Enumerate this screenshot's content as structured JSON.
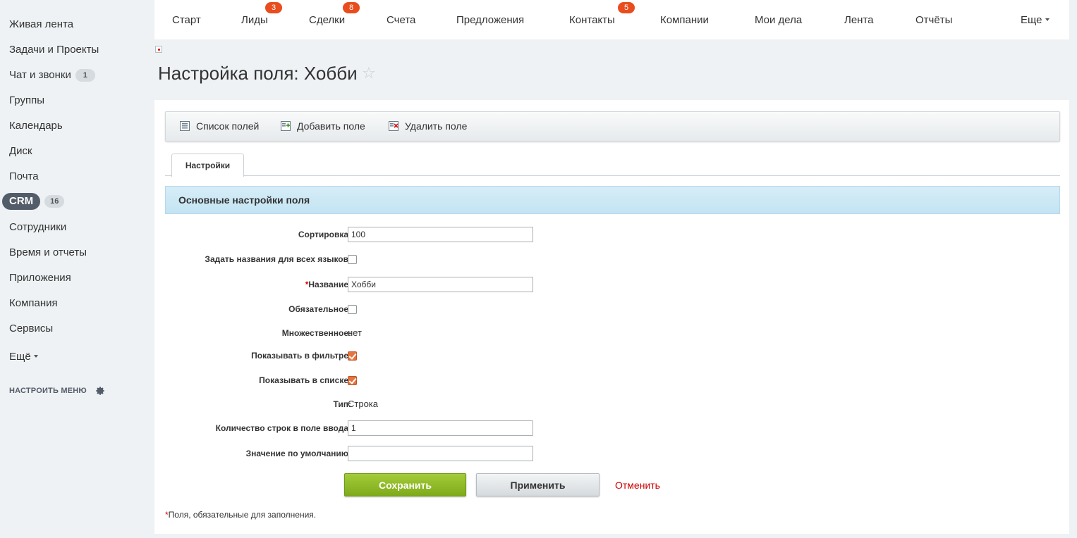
{
  "sidebar": {
    "items": [
      {
        "label": "Живая лента"
      },
      {
        "label": "Задачи и Проекты"
      },
      {
        "label": "Чат и звонки",
        "count": "1"
      },
      {
        "label": "Группы"
      },
      {
        "label": "Календарь"
      },
      {
        "label": "Диск"
      },
      {
        "label": "Почта"
      },
      {
        "label": "CRM",
        "count": "16",
        "active": true
      },
      {
        "label": "Сотрудники"
      },
      {
        "label": "Время и отчеты"
      },
      {
        "label": "Приложения"
      },
      {
        "label": "Компания"
      },
      {
        "label": "Сервисы"
      },
      {
        "label": "Ещё"
      }
    ],
    "config_label": "НАСТРОИТЬ МЕНЮ"
  },
  "topnav": {
    "items": [
      {
        "label": "Старт"
      },
      {
        "label": "Лиды",
        "badge": "3"
      },
      {
        "label": "Сделки",
        "badge": "8"
      },
      {
        "label": "Счета"
      },
      {
        "label": "Предложения"
      },
      {
        "label": "Контакты",
        "badge": "5"
      },
      {
        "label": "Компании"
      },
      {
        "label": "Мои дела"
      },
      {
        "label": "Лента"
      },
      {
        "label": "Отчёты"
      },
      {
        "label": "Еще"
      }
    ]
  },
  "page": {
    "title": "Настройка поля: Хобби",
    "star_icon": "star-outline-icon"
  },
  "toolbar": {
    "list_label": "Список полей",
    "add_label": "Добавить поле",
    "delete_label": "Удалить поле"
  },
  "tabs": [
    {
      "label": "Настройки"
    }
  ],
  "section": {
    "title": "Основные настройки поля"
  },
  "form": {
    "sort": {
      "label": "Сортировка:",
      "value": "100"
    },
    "all_langs": {
      "label": "Задать названия для всех языков:",
      "checked": false
    },
    "name": {
      "required_mark": "*",
      "label": "Название:",
      "value": "Хобби"
    },
    "mandatory": {
      "label": "Обязательное:",
      "checked": false
    },
    "multiple": {
      "label": "Множественное:",
      "value": "нет"
    },
    "show_filter": {
      "label": "Показывать в фильтре:",
      "checked": true
    },
    "show_list": {
      "label": "Показывать в списке:",
      "checked": true
    },
    "type": {
      "label": "Тип:",
      "value": "Строка"
    },
    "rows": {
      "label": "Количество строк в поле ввода:",
      "value": "1"
    },
    "default": {
      "label": "Значение по умолчанию:",
      "value": ""
    }
  },
  "buttons": {
    "save": "Сохранить",
    "apply": "Применить",
    "cancel": "Отменить"
  },
  "footnote": {
    "mark": "*",
    "text": "Поля, обязательные для заполнения."
  },
  "colors": {
    "accent_badge": "#e94c1d",
    "save_green": "#8fb92a",
    "cancel_red": "#cc0000",
    "section_blue": "#cce8f4"
  }
}
